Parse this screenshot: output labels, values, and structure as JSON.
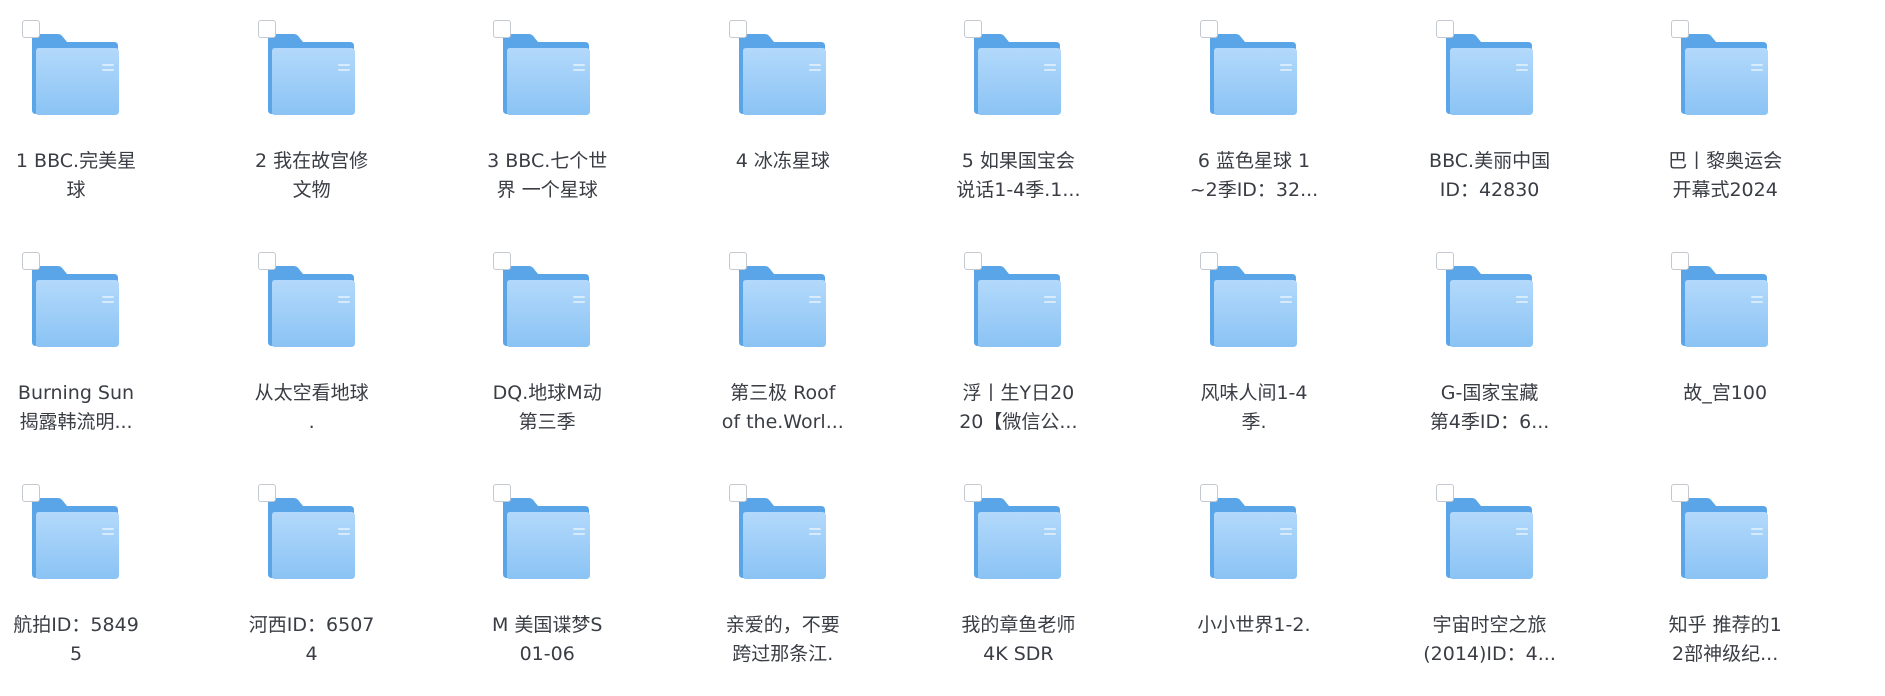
{
  "folder_icon_name": "folder-icon",
  "colors": {
    "folder_back": "#5aa5e8",
    "folder_front_top": "#b3d9fb",
    "folder_front_bottom": "#8ac3f4",
    "label_text": "#3a3d44",
    "checkbox_border": "#c4c8cf"
  },
  "folders": [
    {
      "line1": "1 BBC.完美星",
      "line2": "球"
    },
    {
      "line1": "2 我在故宫修",
      "line2": "文物"
    },
    {
      "line1": "3 BBC.七个世",
      "line2": "界 一个星球"
    },
    {
      "line1": "4 冰冻星球",
      "line2": ""
    },
    {
      "line1": "5 如果国宝会",
      "line2": "说话1-4季.1..."
    },
    {
      "line1": "6 蓝色星球 1",
      "line2": "~2季ID：32..."
    },
    {
      "line1": "BBC.美丽中国",
      "line2": "ID：42830"
    },
    {
      "line1": "巴丨黎奥运会",
      "line2": "开幕式2024"
    },
    {
      "line1": "Burning Sun",
      "line2": "揭露韩流明..."
    },
    {
      "line1": "从太空看地球",
      "line2": "."
    },
    {
      "line1": "DQ.地球M动",
      "line2": "第三季"
    },
    {
      "line1": "第三极 Roof",
      "line2": "of the.Worl..."
    },
    {
      "line1": "浮丨生Y日20",
      "line2": "20【微信公..."
    },
    {
      "line1": "风味人间1-4",
      "line2": "季."
    },
    {
      "line1": "G-国家宝藏",
      "line2": "第4季ID：6..."
    },
    {
      "line1": "故_宫100",
      "line2": ""
    },
    {
      "line1": "航拍ID：5849",
      "line2": "5"
    },
    {
      "line1": "河西ID：6507",
      "line2": "4"
    },
    {
      "line1": "M 美国谍梦S",
      "line2": "01-06"
    },
    {
      "line1": "亲爱的，不要",
      "line2": "跨过那条江."
    },
    {
      "line1": "我的章鱼老师",
      "line2": "4K SDR"
    },
    {
      "line1": "小小世界1-2.",
      "line2": ""
    },
    {
      "line1": "宇宙时空之旅",
      "line2": "(2014)ID：4..."
    },
    {
      "line1": "知乎 推荐的1",
      "line2": "2部神级纪..."
    }
  ]
}
